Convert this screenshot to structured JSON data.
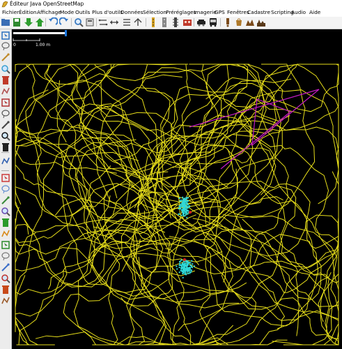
{
  "window": {
    "title": "Éditeur Java OpenStreetMap"
  },
  "menu": [
    {
      "label": "Fichier"
    },
    {
      "label": "Édition"
    },
    {
      "label": "Affichage"
    },
    {
      "label": "Mode"
    },
    {
      "label": "Outils"
    },
    {
      "label": "Plus d'outils"
    },
    {
      "label": "Données"
    },
    {
      "label": "Sélection"
    },
    {
      "label": "Préréglages"
    },
    {
      "label": "Imagerie"
    },
    {
      "label": "GPS"
    },
    {
      "label": "Fenêtres"
    },
    {
      "label": "Cadastre"
    },
    {
      "label": "Scripting"
    },
    {
      "label": "Audio"
    },
    {
      "label": "Aide"
    }
  ],
  "toolbar_icons": [
    "open-file-icon",
    "save-icon",
    "download-icon",
    "upload-icon",
    "undo-icon",
    "redo-icon",
    "zoom-icon",
    "preferences-icon",
    "align-icon",
    "split-icon",
    "combine-icon",
    "reverse-icon",
    "road-icon",
    "highway-icon",
    "railway-icon",
    "building-icon",
    "car-icon",
    "bus-icon",
    "amenity-icon",
    "shop-icon",
    "tourism-icon",
    "landuse-icon"
  ],
  "sidebar_icons": [
    "select-tool-icon",
    "lasso-icon",
    "draw-icon",
    "zoom-tool-icon",
    "delete-tool-icon",
    "improve-way-icon",
    "parallel-icon",
    "measure-icon",
    "camera-icon",
    "note-icon",
    "expand-arrow-icon",
    "layers-icon",
    "validation-icon",
    "tags-icon",
    "relation-icon",
    "history-icon",
    "map-paint-icon",
    "filter-icon",
    "check-icon",
    "funnel-icon",
    "changeset-icon",
    "gps-icon",
    "location-icon",
    "notes-panel-icon"
  ],
  "map": {
    "scale_zero": "0",
    "scale_label": "1.00 m",
    "colors": {
      "track": "#e6dd1a",
      "selection": "#c21bc2",
      "cyan": "#30d8d8",
      "red": "#d42020"
    }
  }
}
